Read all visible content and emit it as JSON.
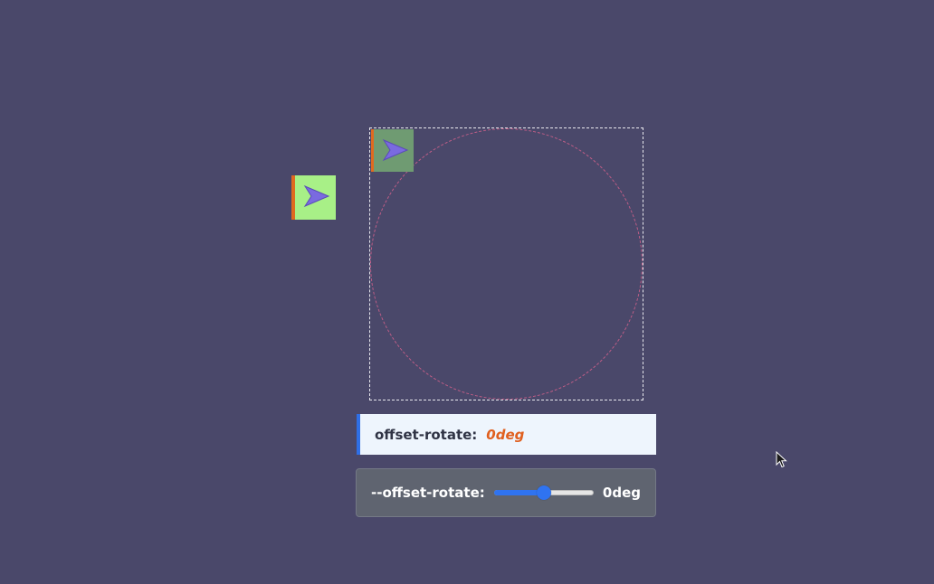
{
  "demo": {
    "code_property": "offset-rotate:",
    "code_value": "0deg",
    "control_label": "--offset-rotate:",
    "control_value": "0deg",
    "slider_fraction": 0.5
  },
  "colors": {
    "background": "#4a486a",
    "free_tile": "#a8f087",
    "path_tile": "#6f9b72",
    "tile_edge": "#e06a1f",
    "arrow": "#7a6ae0",
    "path": "#d6628c",
    "code_accent": "#2f6fe6",
    "code_value": "#e0601f",
    "slider": "#2f73f0"
  },
  "icons": {
    "tile_arrow": "arrow-right-icon",
    "cursor": "mouse-cursor-icon"
  }
}
